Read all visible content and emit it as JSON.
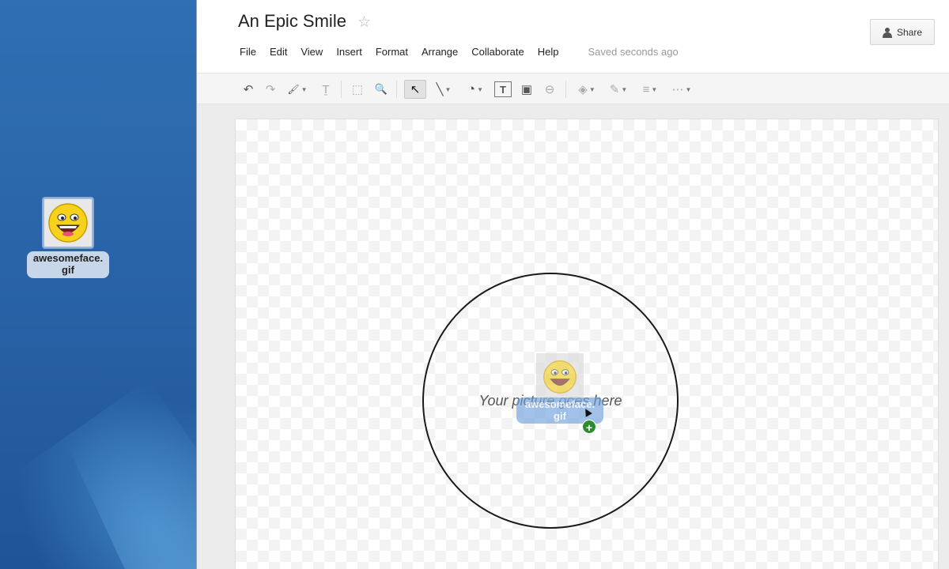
{
  "desktop": {
    "file_icon": {
      "label": "awesomeface.\ngif",
      "icon": "smiley-face-icon"
    }
  },
  "document": {
    "title": "An Epic Smile",
    "star_icon": "☆",
    "share_label": "Share"
  },
  "menu": {
    "items": [
      "File",
      "Edit",
      "View",
      "Insert",
      "Format",
      "Arrange",
      "Collaborate",
      "Help"
    ],
    "saved_status": "Saved seconds ago"
  },
  "toolbar": {
    "icons": [
      "undo-icon",
      "redo-icon",
      "paint-format-icon",
      "clear-format-icon",
      "fit-icon",
      "zoom-icon",
      "select-icon",
      "line-icon",
      "shape-icon",
      "text-box-icon",
      "image-icon",
      "link-icon",
      "fill-color-icon",
      "line-color-icon",
      "line-weight-icon",
      "line-dash-icon"
    ],
    "glyphs": {
      "undo": "↶",
      "redo": "↷",
      "paint": "🖌",
      "clear": "Ṯ",
      "fit": "⬚",
      "zoom": "🔍",
      "select": "↖",
      "line": "╲",
      "shape": "◔",
      "textbox": "T",
      "image": "▣",
      "link": "⊖",
      "fill": "◈",
      "pen": "✎",
      "weight": "≡",
      "dash": "⋯"
    }
  },
  "canvas": {
    "placeholder_text": "Your picture goes here",
    "drag_label": "awesomeface.\ngif",
    "add_badge": "+",
    "cursor": "▲"
  },
  "colors": {
    "desktop_blue": "#2f6fb3",
    "add_badge_green": "#2e8b2e",
    "drag_label_blue": "#6ea0dc"
  }
}
